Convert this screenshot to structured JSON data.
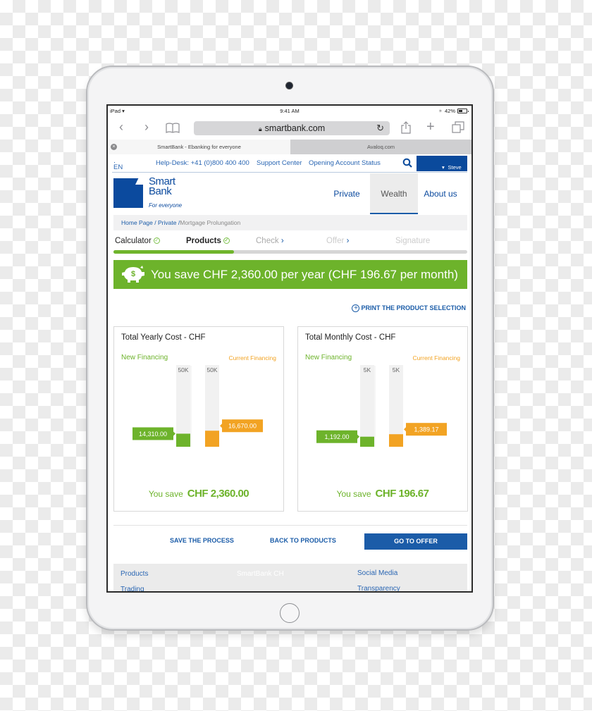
{
  "device": {
    "status_bar": {
      "carrier": "iPad",
      "time": "9:41 AM",
      "battery": "42%"
    }
  },
  "browser": {
    "url": "smartbank.com",
    "tabs": [
      {
        "label": "SmartBank - Ebanking for everyone",
        "active": true
      },
      {
        "label": "Avaloq.com",
        "active": false
      }
    ]
  },
  "topbar": {
    "language": "EN",
    "helpdesk": "Help-Desk: +41 (0)800 400 400",
    "support": "Support Center",
    "account_status": "Opening Account Status",
    "user": "Steve Bauhmann"
  },
  "brand": {
    "name_line1": "Smart",
    "name_line2": "Bank",
    "tagline": "For everyone",
    "color": "#0b4a9e"
  },
  "nav": {
    "items": [
      {
        "label": "Private",
        "active": false
      },
      {
        "label": "Wealth",
        "active": true
      },
      {
        "label": "About us",
        "active": false
      }
    ]
  },
  "breadcrumb": {
    "items": [
      "Home Page",
      "Private"
    ],
    "current": "Mortgage Prolungation"
  },
  "steps": {
    "items": [
      {
        "label": "Calculator",
        "state": "done"
      },
      {
        "label": "Products",
        "state": "done"
      },
      {
        "label": "Check",
        "state": "next"
      },
      {
        "label": "Offer",
        "state": "next"
      },
      {
        "label": "Signature",
        "state": "future"
      }
    ],
    "progress": 0.34
  },
  "banner": {
    "text": "You save CHF 2,360.00 per year (CHF 196.67 per month)",
    "color": "#6db32b"
  },
  "print_link": "PRINT THE PRODUCT SELECTION",
  "cards": [
    {
      "title": "Total Yearly Cost - CHF",
      "new_label": "New Financing",
      "current_label": "Current Financing",
      "saving_label": "You save",
      "saving_value": "CHF 2,360.00"
    },
    {
      "title": "Total Monthly Cost - CHF",
      "new_label": "New Financing",
      "current_label": "Current Financing",
      "saving_label": "You save",
      "saving_value": "CHF 196.67"
    }
  ],
  "chart_data": [
    {
      "type": "bar",
      "title": "Total Yearly Cost - CHF",
      "categories": [
        "New Financing",
        "Current Financing"
      ],
      "values": [
        14310.0,
        16670.0
      ],
      "value_labels": [
        "14,310.00",
        "16,670.00"
      ],
      "max_labels": [
        "50K",
        "50K"
      ],
      "ylim": [
        0,
        50000
      ],
      "colors": [
        "#6db32b",
        "#f2a323"
      ]
    },
    {
      "type": "bar",
      "title": "Total Monthly Cost - CHF",
      "categories": [
        "New Financing",
        "Current Financing"
      ],
      "values": [
        1192.0,
        1389.17
      ],
      "value_labels": [
        "1,192.00",
        "1,389.17"
      ],
      "max_labels": [
        "5K",
        "5K"
      ],
      "ylim": [
        0,
        5000
      ],
      "colors": [
        "#6db32b",
        "#f2a323"
      ]
    }
  ],
  "actions": {
    "save": "SAVE THE PROCESS",
    "back": "BACK TO PRODUCTS",
    "next": "GO TO OFFER"
  },
  "footer": {
    "col1": [
      "Products",
      "Trading"
    ],
    "center": "SmartBank CH",
    "col3": [
      "Social Media",
      "Transparency"
    ]
  }
}
